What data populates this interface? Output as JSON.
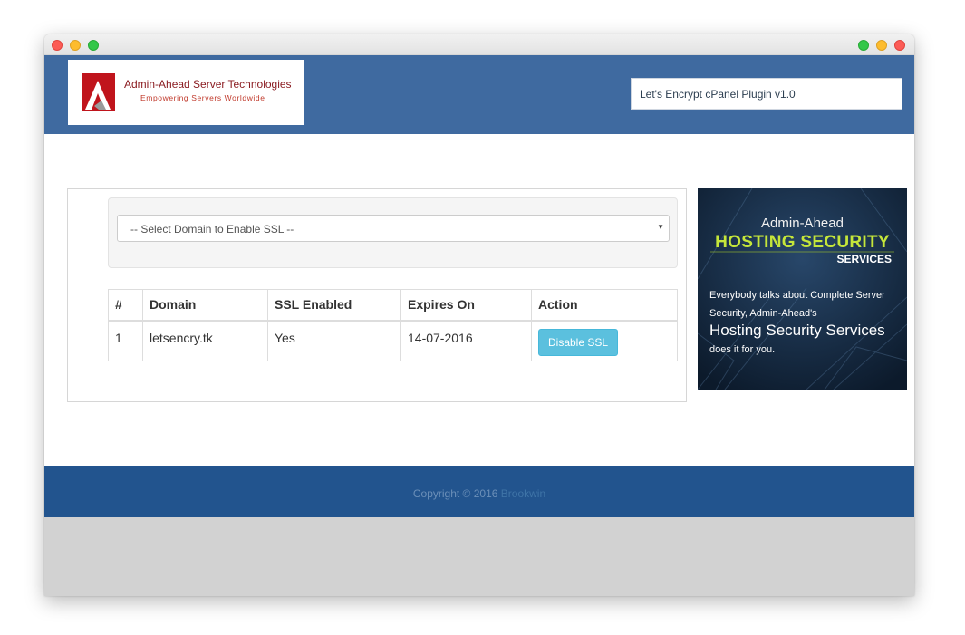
{
  "header": {
    "company_name": "Admin-Ahead Server Technologies",
    "tagline": "Empowering Servers Worldwide",
    "plugin_label": "Let's Encrypt cPanel Plugin v1.0"
  },
  "form": {
    "domain_select_value": "-- Select Domain to Enable SSL --"
  },
  "table": {
    "headers": [
      "#",
      "Domain",
      "SSL Enabled",
      "Expires On",
      "Action"
    ],
    "rows": [
      {
        "num": "1",
        "domain": "letsencry.tk",
        "ssl": "Yes",
        "expires": "14-07-2016",
        "action": "Disable SSL"
      }
    ]
  },
  "ad": {
    "brand": "Admin-Ahead",
    "headline": "HOSTING SECURITY",
    "sub": "SERVICES",
    "line1": "Everybody talks about Complete Server",
    "line2": "Security, Admin-Ahead's",
    "line3": "Hosting Security Services",
    "line4": "does it for you."
  },
  "footer": {
    "copyright": "Copyright © 2016",
    "link": "Brookwin"
  },
  "colors": {
    "header_bg": "#3f6aa0",
    "footer_bg": "#22548e",
    "button_info": "#5bc0de",
    "ad_headline": "#c5e63a"
  }
}
